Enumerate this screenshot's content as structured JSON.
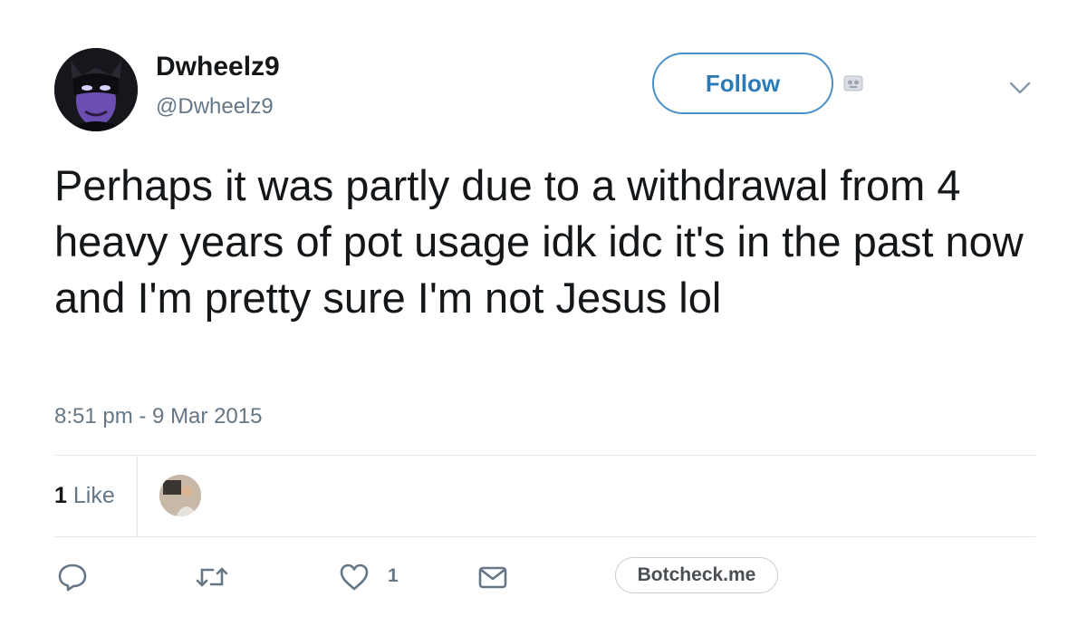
{
  "user": {
    "display_name": "Dwheelz9",
    "handle": "@Dwheelz9",
    "avatar_icon": "masked-face-avatar"
  },
  "follow_button": {
    "label": "Follow"
  },
  "tweet": {
    "text": "Perhaps it was partly due to a withdrawal from 4 heavy years of pot usage idk idc it's in the past now and I'm pretty sure I'm not Jesus lol",
    "timestamp": "8:51 pm - 9 Mar 2015"
  },
  "stats": {
    "likes_count": "1",
    "likes_label": "Like"
  },
  "actions": {
    "reply_icon": "reply-icon",
    "retweet_icon": "retweet-icon",
    "like_icon": "heart-icon",
    "like_count": "1",
    "dm_icon": "envelope-icon"
  },
  "botcheck": {
    "label": "Botcheck.me"
  },
  "colors": {
    "text": "#14171a",
    "secondary": "#657786",
    "accent": "#2b7bb9",
    "divider": "#e1e8ed"
  }
}
